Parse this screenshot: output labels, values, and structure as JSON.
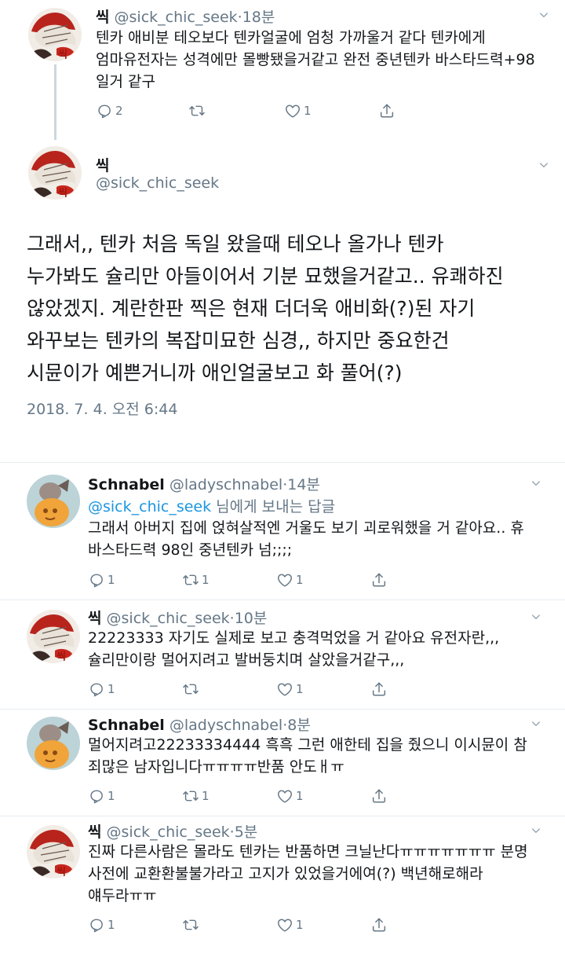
{
  "tweets": [
    {
      "name": "씩",
      "handle": "@sick_chic_seek",
      "time": "18분",
      "lines": [
        "텐카 애비분 테오보다 텐카얼굴에 엄청 가까울거 같다 텐카에게",
        "엄마유전자는 성격에만 몰빵됐을거같고 완전 중년텐카 바스타드력+98",
        "일거 같구"
      ],
      "reply_count": "2",
      "retweet_count": "",
      "like_count": "1"
    }
  ],
  "main": {
    "name": "씩",
    "handle": "@sick_chic_seek",
    "lines": [
      "그래서,, 텐카 처음 독일 왔을때 테오나 올가나 텐카",
      "누가봐도 슐리만 아들이어서 기분 묘했을거같고.. 유쾌하진",
      "않았겠지. 계란한판 찍은 현재 더더욱 애비화(?)된 자기",
      "와꾸보는 텐카의 복잡미묘한 심경,, 하지만 중요한건",
      "시뮨이가 예쁜거니까 애인얼굴보고 화 풀어(?)"
    ],
    "date": "2018. 7. 4. 오전 6:44"
  },
  "replies": [
    {
      "name": "Schnabel",
      "handle": "@ladyschnabel",
      "time": "14분",
      "replying_handle": "@sick_chic_seek",
      "replying_suffix": " 님에게 보내는 답글",
      "lines": [
        "그래서 아버지 집에 얹혀살적엔 거울도 보기 괴로워했을 거 같아요.. 휴",
        "바스타드력 98인 중년텐카 넘;;;;"
      ],
      "reply_count": "1",
      "retweet_count": "1",
      "like_count": "1"
    },
    {
      "name": "씩",
      "handle": "@sick_chic_seek",
      "time": "10분",
      "lines": [
        "22223333 자기도 실제로 보고 충격먹었을 거 같아요 유전자란,,,",
        "슐리만이랑 멀어지려고 발버둥치며 살았을거같구,,,"
      ],
      "reply_count": "1",
      "retweet_count": "",
      "like_count": "1"
    },
    {
      "name": "Schnabel",
      "handle": "@ladyschnabel",
      "time": "8분",
      "lines": [
        "멀어지려고22233334444 흑흑 그런 애한테 집을 줬으니 이시뮨이 참",
        "죄많은 남자입니다ㅠㅠㅠㅠ반품 안도ㅐㅠ"
      ],
      "reply_count": "1",
      "retweet_count": "1",
      "like_count": "1"
    },
    {
      "name": "씩",
      "handle": "@sick_chic_seek",
      "time": "5분",
      "lines": [
        "진짜 다른사람은 몰라도 텐카는 반품하면 크닐난다ㅠㅠㅠㅠㅠㅠㅠ 분명",
        "사전에 교환환불불가라고 고지가 있었을거에여(?) 백년해로해라",
        "얘두라ㅠㅠ"
      ],
      "reply_count": "1",
      "retweet_count": "",
      "like_count": "1"
    }
  ],
  "icons": {
    "reply": "reply-icon",
    "retweet": "retweet-icon",
    "like": "heart-icon",
    "share": "share-icon",
    "more": "chevron-down-icon"
  },
  "colors": {
    "text": "#14171a",
    "secondary": "#657786",
    "link": "#1b95e0",
    "divider": "#e6ecf0",
    "thread_line": "#ccd6dd"
  }
}
